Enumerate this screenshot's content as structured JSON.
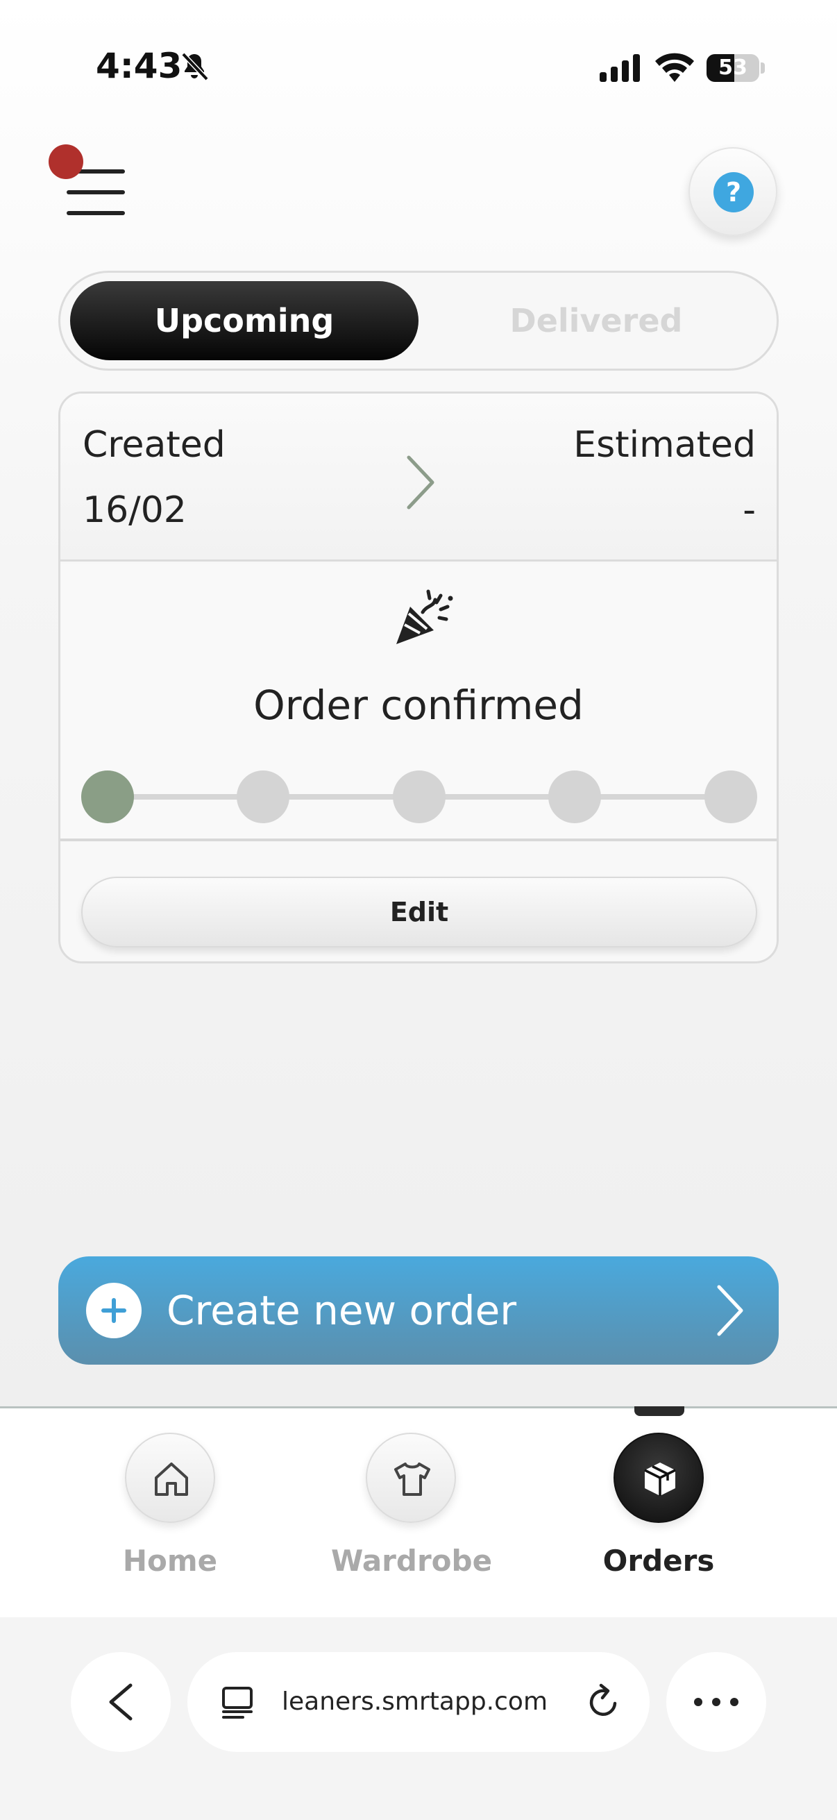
{
  "status_bar": {
    "time": "4:43",
    "battery": "53",
    "battery_level": 0.53,
    "icons": [
      "bell-off-icon",
      "cellular-signal-icon",
      "wifi-icon",
      "battery-icon"
    ]
  },
  "header": {
    "menu_icon": "hamburger-menu-icon",
    "help_icon": "question-mark-icon",
    "help_glyph": "?"
  },
  "tabs_segment": {
    "upcoming": "Upcoming",
    "delivered": "Delivered",
    "selected": "Upcoming"
  },
  "order_card": {
    "created_label": "Created",
    "created_value": "16/02",
    "estimated_label": "Estimated",
    "estimated_value": "-",
    "status_icon": "party-popper-icon",
    "status": "Order confirmed",
    "progress_steps_total": 5,
    "progress_steps_completed": 1,
    "edit_label": "Edit"
  },
  "create_order": {
    "label": "Create new order",
    "icon": "plus-circle-icon"
  },
  "bottom_nav": {
    "items": [
      {
        "label": "Home",
        "icon": "home-icon",
        "active": false
      },
      {
        "label": "Wardrobe",
        "icon": "t-shirt-icon",
        "active": false
      },
      {
        "label": "Orders",
        "icon": "package-box-icon",
        "active": true
      }
    ]
  },
  "browser": {
    "url": "leaners.smrtapp.com",
    "icons": [
      "back-chevron-icon",
      "tabs-icon",
      "reload-icon",
      "more-dots-icon"
    ]
  },
  "colors": {
    "accent_blue": "#4aa9dd",
    "progress_done": "#8a9e86",
    "notification_dot": "#b0302c"
  }
}
